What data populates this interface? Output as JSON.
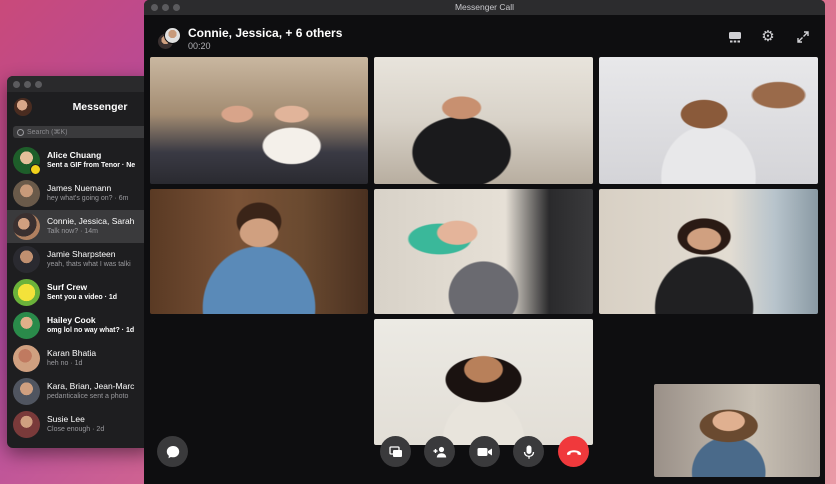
{
  "messenger": {
    "title": "Messenger",
    "search_placeholder": "Search (⌘K)",
    "conversations": [
      {
        "name": "Alice Chuang",
        "preview": "Sent a GIF from Tenor · Ne",
        "unread": true
      },
      {
        "name": "James Nuemann",
        "preview": "hey what's going on? · 6m",
        "unread": false
      },
      {
        "name": "Connie, Jessica, Sarah",
        "preview": "Talk now? · 14m",
        "unread": false,
        "selected": true
      },
      {
        "name": "Jamie Sharpsteen",
        "preview": "yeah, thats what I was talki",
        "unread": false
      },
      {
        "name": "Surf Crew",
        "preview": "Sent you a video · 1d",
        "unread": true
      },
      {
        "name": "Hailey Cook",
        "preview": "omg lol no way what? · 1d",
        "unread": true
      },
      {
        "name": "Karan Bhatia",
        "preview": "heh no · 1d",
        "unread": false
      },
      {
        "name": "Kara, Brian, Jean-Marc",
        "preview": "pedanticalice sent a photo",
        "unread": false
      },
      {
        "name": "Susie Lee",
        "preview": "Close enough · 2d",
        "unread": false
      }
    ]
  },
  "call": {
    "window_title": "Messenger Call",
    "participants_label": "Connie, Jessica, + 6 others",
    "duration": "00:20",
    "header_icons": [
      "grid-icon",
      "gear-icon",
      "expand-icon"
    ],
    "controls": [
      "chat-icon",
      "screen-share-icon",
      "add-person-icon",
      "video-icon",
      "microphone-icon",
      "end-call-icon"
    ],
    "end_call_color": "#f0393c"
  }
}
